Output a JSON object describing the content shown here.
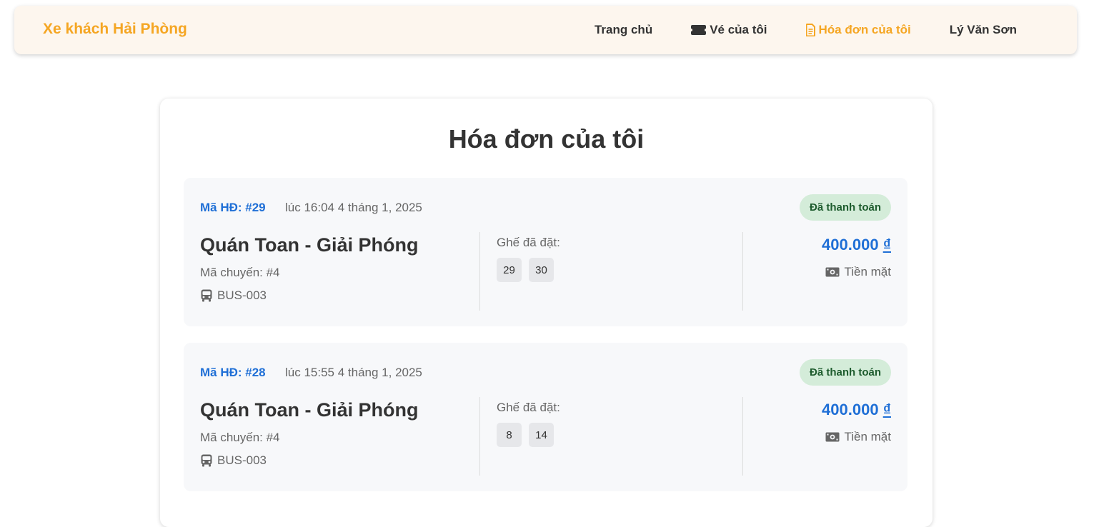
{
  "navbar": {
    "brand": "Xe khách Hải Phòng",
    "links": [
      {
        "label": "Trang chủ"
      },
      {
        "label": "Vé của tôi",
        "icon": "ticket-icon"
      },
      {
        "label": "Hóa đơn của tôi",
        "icon": "receipt-icon",
        "active": true
      },
      {
        "label": "Lý Văn Sơn",
        "icon": "chevron-down-icon"
      }
    ]
  },
  "page": {
    "title": "Hóa đơn của tôi"
  },
  "invoices": [
    {
      "id": "Mã HĐ: #29",
      "time": "lúc 16:04 4 tháng 1, 2025",
      "status": "Đã thanh toán",
      "route": "Quán Toan - Giải Phóng",
      "trip": "Mã chuyến: #4",
      "bus": "BUS-003",
      "seats_label": "Ghế đã đặt:",
      "seats": [
        "29",
        "30"
      ],
      "price": "400.000",
      "currency": "₫",
      "payment": "Tiền mặt"
    },
    {
      "id": "Mã HĐ: #28",
      "time": "lúc 15:55 4 tháng 1, 2025",
      "status": "Đã thanh toán",
      "route": "Quán Toan - Giải Phóng",
      "trip": "Mã chuyến: #4",
      "bus": "BUS-003",
      "seats_label": "Ghế đã đặt:",
      "seats": [
        "8",
        "14"
      ],
      "price": "400.000",
      "currency": "₫",
      "payment": "Tiền mặt"
    }
  ],
  "colors": {
    "brand": "#f5a623",
    "accent_blue": "#1f6fd6",
    "badge_bg": "#d4ecd9",
    "badge_text": "#1e5c2e",
    "navbar_bg": "#fdf6ee"
  }
}
